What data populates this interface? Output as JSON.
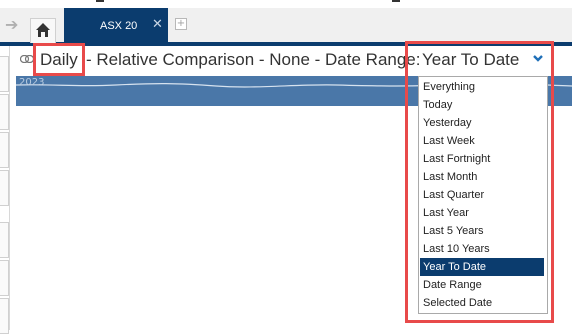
{
  "tabs": [
    {
      "label": "ASX 20",
      "active": true
    }
  ],
  "icons": {
    "back": "back-arrow-icon",
    "home": "home-icon",
    "close": "close-icon",
    "add_tab": "plus-icon",
    "link": "link-icon",
    "chevron": "chevron-down-icon"
  },
  "header": {
    "interval": "Daily",
    "title": "- Relative Comparison - None - Date Range:",
    "range_value": "Year To Date"
  },
  "chart": {
    "year_label": "2023"
  },
  "date_range_options": [
    {
      "label": "Everything"
    },
    {
      "label": "Today"
    },
    {
      "label": "Yesterday"
    },
    {
      "label": "Last Week"
    },
    {
      "label": "Last Fortnight"
    },
    {
      "label": "Last Month"
    },
    {
      "label": "Last Quarter"
    },
    {
      "label": "Last Year"
    },
    {
      "label": "Last 5 Years"
    },
    {
      "label": "Last 10 Years"
    },
    {
      "label": "Year To Date",
      "selected": true
    },
    {
      "label": "Date Range"
    },
    {
      "label": "Selected Date"
    }
  ],
  "colors": {
    "navy": "#0b3c6e",
    "strip": "#4a77a8",
    "highlight": "#e84a4a"
  }
}
